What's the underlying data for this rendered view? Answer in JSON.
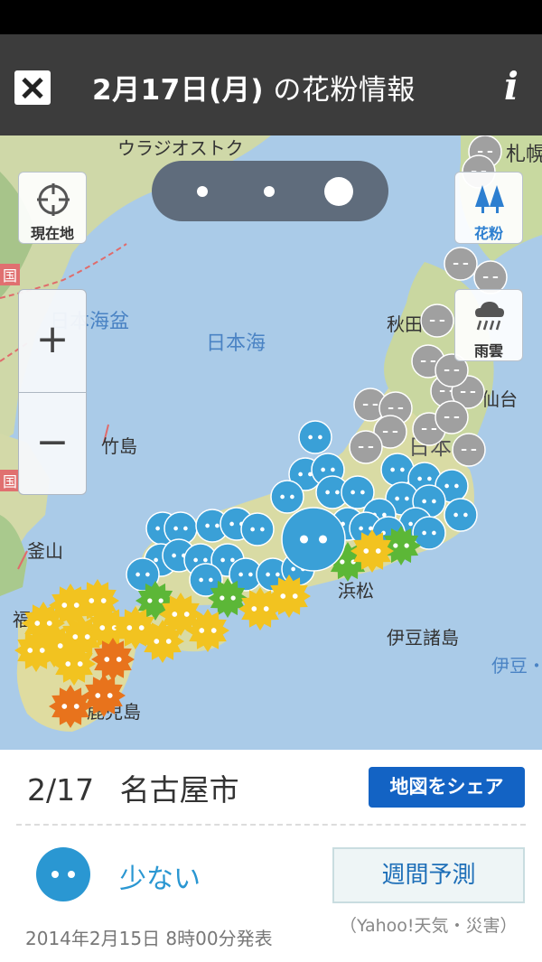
{
  "header": {
    "date": "2月17日(月)",
    "title_suffix": "の花粉情報",
    "info_glyph": "i",
    "close_icon": "close-icon",
    "info_icon": "info-icon"
  },
  "map": {
    "labels": {
      "vladivostok": "ウラジオストク",
      "sapporo": "札幌",
      "japan_sea_basin": "日本海盆",
      "japan_sea": "日本海",
      "akita": "秋田",
      "sendai": "仙台",
      "takeshima": "竹島",
      "busan": "釜山",
      "hamamatsu": "浜松",
      "izu_islands": "伊豆諸島",
      "fukuoka": "福岡",
      "kagoshima": "鹿児島",
      "izu_ogasawara": "伊豆・小笠",
      "country_mark": "国",
      "country_mark_2": "国",
      "nihon": "日本"
    },
    "controls": {
      "locate_label": "現在地",
      "pollen_label": "花粉",
      "rain_label": "雨雲",
      "zoom_in": "+",
      "zoom_out": "−"
    },
    "timeline_dots": 3,
    "timeline_selected": 3
  },
  "pollen_levels": {
    "colors": {
      "none": "#a0a0a0",
      "low": "#3aa0d7",
      "moderate": "#5cb737",
      "high": "#f2c320",
      "very_high": "#e8731c"
    }
  },
  "bottom": {
    "date": "2/17",
    "city": "名古屋市",
    "share_label": "地図をシェア",
    "level_label": "少ない",
    "level_color": "#2a97d2",
    "weekly_label": "週間予測",
    "source": "（Yahoo!天気・災害）",
    "published": "2014年2月15日 8時00分発表"
  }
}
